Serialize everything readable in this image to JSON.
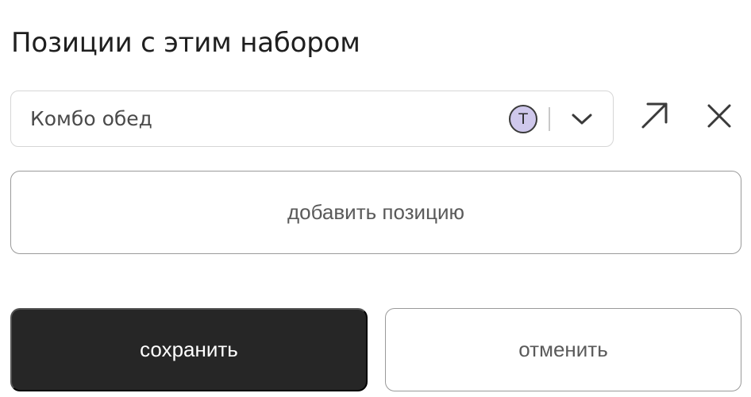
{
  "section": {
    "title": "Позиции с этим набором"
  },
  "position_select": {
    "value": "Комбо обед",
    "badge_letter": "Т",
    "badge_color": "#cfc8ec",
    "dropdown_icon": "chevron-down-icon",
    "open_icon": "arrow-up-right-icon",
    "remove_icon": "close-icon"
  },
  "actions": {
    "add_label": "добавить позицию",
    "save_label": "сохранить",
    "cancel_label": "отменить"
  },
  "colors": {
    "primary_button": "#262626",
    "border": "#9a9a9a"
  }
}
